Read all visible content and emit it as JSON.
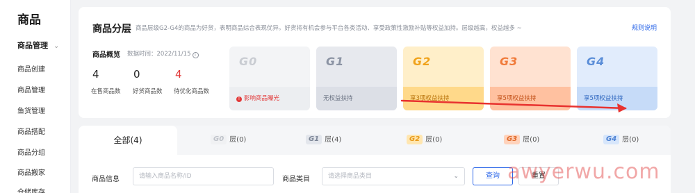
{
  "sidebar": {
    "title": "商品",
    "group": "商品管理",
    "items": [
      "商品创建",
      "商品管理",
      "鱼货管理",
      "商品搭配",
      "商品分组",
      "商品搬家",
      "仓储库存"
    ]
  },
  "tier_card": {
    "title": "商品分层",
    "description": "商品层级G2-G4的商品为好货，表明商品综合表现优异。好货将有机会参与平台各类活动、享受政策性激励补贴等权益加持。层级越高，权益越多 ~",
    "link": "规则说明",
    "overview": {
      "title": "商品概览",
      "time": "数据时间：2022/11/15",
      "stats": [
        {
          "value": "4",
          "label": "在售商品数"
        },
        {
          "value": "0",
          "label": "好货商品数"
        },
        {
          "value": "4",
          "label": "待优化商品数"
        }
      ]
    },
    "tiers": [
      {
        "name": "G0",
        "desc": "影响商品曝光"
      },
      {
        "name": "G1",
        "desc": "无权益扶持"
      },
      {
        "name": "G2",
        "desc": "享3项权益扶持"
      },
      {
        "name": "G3",
        "desc": "享5项权益扶持"
      },
      {
        "name": "G4",
        "desc": "享5项权益扶持"
      }
    ]
  },
  "tabs": [
    {
      "label": "全部(4)"
    },
    {
      "badge": "G0",
      "label": "层(0)"
    },
    {
      "badge": "G1",
      "label": "层(4)"
    },
    {
      "badge": "G2",
      "label": "层(0)"
    },
    {
      "badge": "G3",
      "label": "层(0)"
    },
    {
      "badge": "G4",
      "label": "层(0)"
    }
  ],
  "filters": {
    "info_label": "商品信息",
    "info_placeholder": "请输入商品名称/ID",
    "category_label": "商品类目",
    "category_placeholder": "请选择商品类目",
    "query_button": "查询",
    "reset_button": "重置"
  },
  "watermark": "awyerwu.com",
  "colors": {
    "accent": "#2b66e8",
    "alert_red": "#e23a3a",
    "arrow_red": "#e8322f"
  }
}
